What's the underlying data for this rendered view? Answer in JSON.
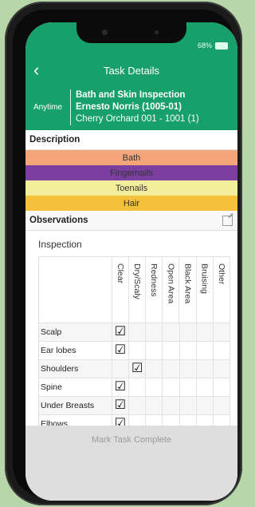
{
  "status": {
    "battery_text": "68%",
    "battery_color": "#d7ffe9"
  },
  "nav": {
    "title": "Task Details",
    "back_icon": "chevron-left-icon"
  },
  "task": {
    "time": "Anytime",
    "name": "Bath and Skin Inspection",
    "resident": "Ernesto Norris (1005-01)",
    "location": "Cherry Orchard 001 - 1001 (1)"
  },
  "description": {
    "header": "Description",
    "items": [
      {
        "label": "Bath",
        "color": "#f4a67a"
      },
      {
        "label": "Fingernails",
        "color": "#7b3fa0"
      },
      {
        "label": "Toenails",
        "color": "#f3ee9b"
      },
      {
        "label": "Hair",
        "color": "#f3c23a"
      }
    ]
  },
  "observations": {
    "header": "Observations",
    "edit_icon": "edit-icon",
    "inspection_label": "Inspection",
    "columns": [
      "Clear",
      "Dry/Scaly",
      "Redness",
      "Open Area",
      "Black Area",
      "Bruising",
      "Other"
    ],
    "rows": [
      {
        "name": "Scalp",
        "checked": [
          true,
          false,
          false,
          false,
          false,
          false,
          false
        ]
      },
      {
        "name": "Ear lobes",
        "checked": [
          true,
          false,
          false,
          false,
          false,
          false,
          false
        ]
      },
      {
        "name": "Shoulders",
        "checked": [
          false,
          true,
          false,
          false,
          false,
          false,
          false
        ]
      },
      {
        "name": "Spine",
        "checked": [
          true,
          false,
          false,
          false,
          false,
          false,
          false
        ]
      },
      {
        "name": "Under Breasts",
        "checked": [
          true,
          false,
          false,
          false,
          false,
          false,
          false
        ]
      },
      {
        "name": "Elbows",
        "checked": [
          true,
          false,
          false,
          false,
          false,
          false,
          false
        ]
      }
    ],
    "check_glyph": "☑"
  },
  "actions": {
    "mark_complete_label": "Mark Task Complete"
  },
  "colors": {
    "accent": "#18a06b"
  }
}
